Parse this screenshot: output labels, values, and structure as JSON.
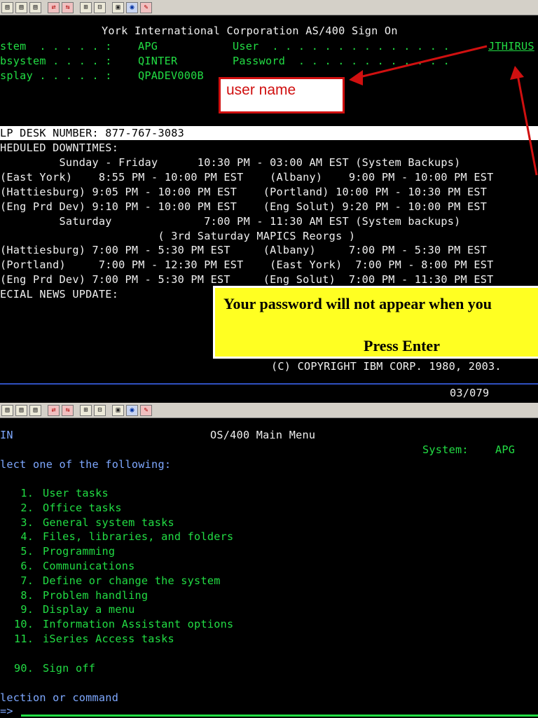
{
  "top_toolbar": {
    "buttons": [
      {
        "icon": "window-icon",
        "glyph": "▤"
      },
      {
        "icon": "window-icon",
        "glyph": "▤"
      },
      {
        "icon": "window-icon",
        "glyph": "▤"
      },
      {
        "icon": "send-icon",
        "glyph": "⇄"
      },
      {
        "icon": "receive-icon",
        "glyph": "⇆"
      },
      {
        "icon": "macro-icon",
        "glyph": "⊞"
      },
      {
        "icon": "record-icon",
        "glyph": "⊟"
      },
      {
        "icon": "print-icon",
        "glyph": "▣"
      },
      {
        "icon": "palette-icon",
        "glyph": "◉"
      },
      {
        "icon": "edit-icon",
        "glyph": "✎"
      }
    ]
  },
  "signon": {
    "title": "York International Corporation AS/400 Sign On",
    "system_label": "stem  . . . . . :",
    "system_value": "APG",
    "subsystem_label": "bsystem . . . . :",
    "subsystem_value": "QINTER",
    "display_label": "splay . . . . . :",
    "display_value": "QPADEV000B",
    "user_label": "User  . . . . . . . . . . . . . .",
    "user_value": "JTHIRUS",
    "password_label": "Password  . . . . . . . . . . . .",
    "help_desk": "LP DESK NUMBER: 877-767-3083",
    "scheduled_header": "HEDULED DOWNTIMES:",
    "schedule_lines": [
      "         Sunday - Friday      10:30 PM - 03:00 AM EST (System Backups)",
      "(East York)    8:55 PM - 10:00 PM EST    (Albany)    9:00 PM - 10:00 PM EST",
      "(Hattiesburg) 9:05 PM - 10:00 PM EST    (Portland) 10:00 PM - 10:30 PM EST",
      "(Eng Prd Dev) 9:10 PM - 10:00 PM EST    (Eng Solut) 9:20 PM - 10:00 PM EST",
      "         Saturday              7:00 PM - 11:30 AM EST (System backups)",
      "                        ( 3rd Saturday MAPICS Reorgs )",
      "(Hattiesburg) 7:00 PM - 5:30 PM EST     (Albany)     7:00 PM - 5:30 PM EST",
      "(Portland)     7:00 PM - 12:30 PM EST    (East York)  7:00 PM - 8:00 PM EST",
      "(Eng Prd Dev) 7:00 PM - 5:30 PM EST     (Eng Solut)  7:00 PM - 11:30 PM EST"
    ],
    "news_header": "ECIAL NEWS UPDATE:",
    "copyright": "(C) COPYRIGHT IBM CORP. 1980, 2003.",
    "status_position": "03/079"
  },
  "annotations": {
    "username_callout": "user name",
    "password_note": "Your password will not appear when you",
    "press_enter": "Press Enter",
    "accent_red": "#d01010",
    "accent_yellow": "#ffff22"
  },
  "main_menu": {
    "menu_id": "IN",
    "title": "OS/400 Main Menu",
    "system_label": "System:",
    "system_value": "APG",
    "instruction": "lect one of the following:",
    "options": [
      {
        "num": " 1.",
        "label": "User tasks"
      },
      {
        "num": " 2.",
        "label": "Office tasks"
      },
      {
        "num": " 3.",
        "label": "General system tasks"
      },
      {
        "num": " 4.",
        "label": "Files, libraries, and folders"
      },
      {
        "num": " 5.",
        "label": "Programming"
      },
      {
        "num": " 6.",
        "label": "Communications"
      },
      {
        "num": " 7.",
        "label": "Define or change the system"
      },
      {
        "num": " 8.",
        "label": "Problem handling"
      },
      {
        "num": " 9.",
        "label": "Display a menu"
      },
      {
        "num": "10.",
        "label": "Information Assistant options"
      },
      {
        "num": "11.",
        "label": "iSeries Access tasks"
      }
    ],
    "signoff": {
      "num": "90.",
      "label": "Sign off"
    },
    "command_label": "lection or command",
    "prompt": "=>"
  },
  "colors": {
    "terminal_green": "#22dd44",
    "terminal_white": "#f0f0f0",
    "terminal_blue": "#7ea8ff",
    "background": "#000000"
  }
}
